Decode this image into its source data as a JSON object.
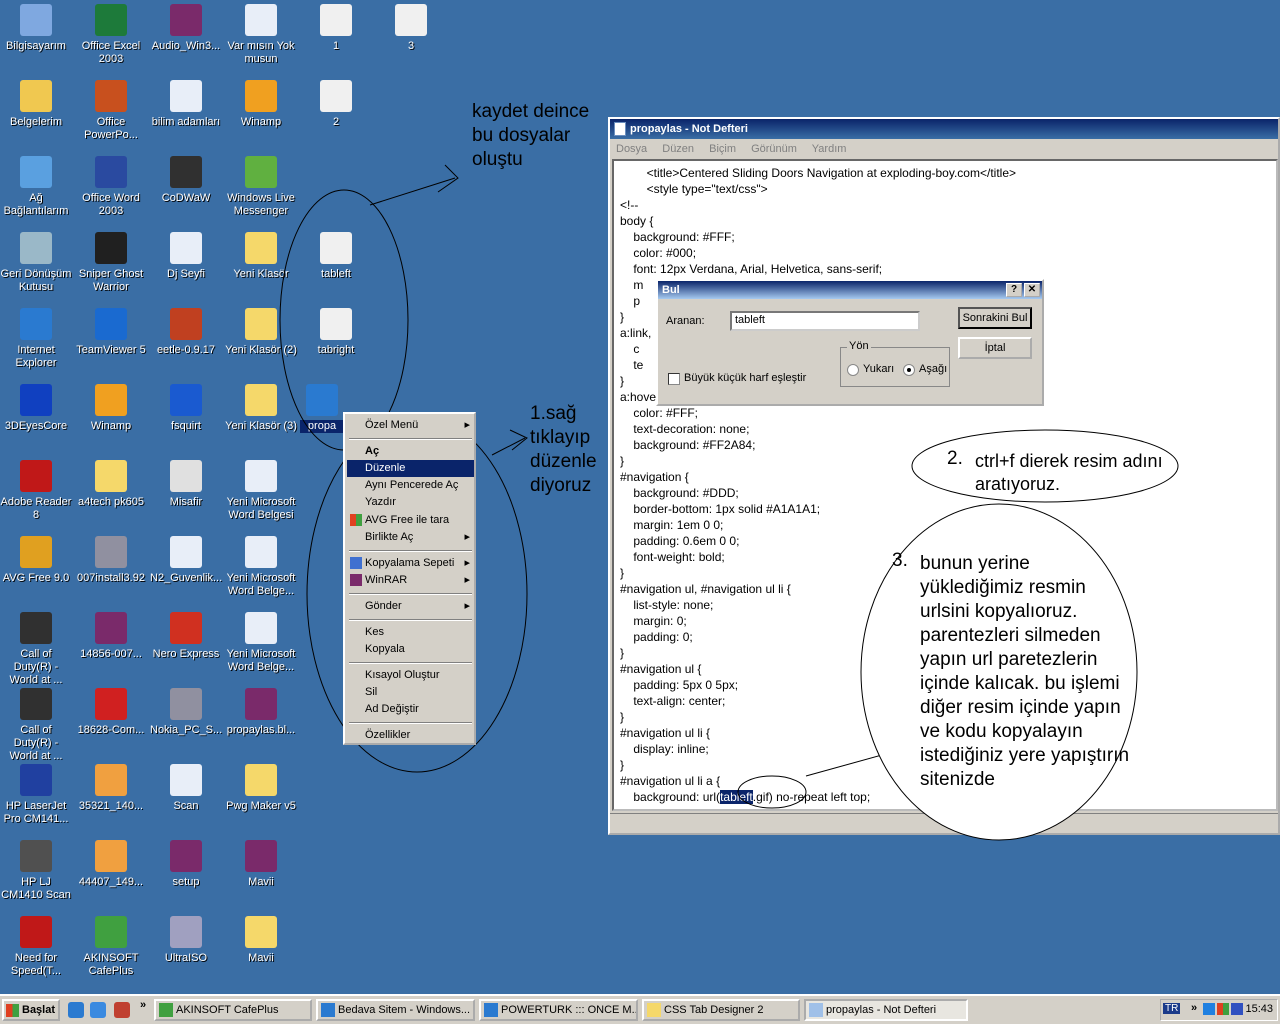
{
  "desktop_icons": [
    {
      "label": "Bilgisayarım",
      "icon": "computer-icon",
      "color": "#7fa8e0"
    },
    {
      "label": "Office Excel 2003",
      "icon": "excel-icon",
      "color": "#1d7a3a"
    },
    {
      "label": "Audio_Win3...",
      "icon": "winrar-archive-icon",
      "color": "#7a2a6a"
    },
    {
      "label": "Var mısın Yok musun",
      "icon": "word-doc-icon",
      "color": "#e8eef8"
    },
    {
      "label": "1",
      "icon": "image-file-icon",
      "color": "#f0f0f0"
    },
    {
      "label": "3",
      "icon": "image-file-icon",
      "color": "#f0f0f0"
    },
    {
      "label": "Belgelerim",
      "icon": "my-documents-icon",
      "color": "#f0c850"
    },
    {
      "label": "Office PowerPo...",
      "icon": "powerpoint-icon",
      "color": "#c8501e"
    },
    {
      "label": "bilim adamları",
      "icon": "word-doc-icon",
      "color": "#e8eef8"
    },
    {
      "label": "Winamp",
      "icon": "winamp-icon",
      "color": "#f0a020"
    },
    {
      "label": "2",
      "icon": "image-file-icon",
      "color": "#f0f0f0"
    },
    {
      "label": "Ağ Bağlantılarım",
      "icon": "network-icon",
      "color": "#5aa0e0"
    },
    {
      "label": "Office Word 2003",
      "icon": "word-icon",
      "color": "#2a4aa0"
    },
    {
      "label": "CoDWaW",
      "icon": "star-game-icon",
      "color": "#303030"
    },
    {
      "label": "Windows Live Messenger",
      "icon": "messenger-icon",
      "color": "#60b040"
    },
    {
      "label": "Geri Dönüşüm Kutusu",
      "icon": "recycle-bin-icon",
      "color": "#9ab8c8"
    },
    {
      "label": "Sniper Ghost Warrior",
      "icon": "crosshair-icon",
      "color": "#202020"
    },
    {
      "label": "Dj Seyfi",
      "icon": "mp3-file-icon",
      "color": "#e8eef8"
    },
    {
      "label": "Yeni Klasör",
      "icon": "folder-icon",
      "color": "#f5d86a"
    },
    {
      "label": "tableft",
      "icon": "image-file-icon",
      "color": "#f0f0f0"
    },
    {
      "label": "Internet Explorer",
      "icon": "internet-explorer-icon",
      "color": "#2a7ad0"
    },
    {
      "label": "TeamViewer 5",
      "icon": "teamviewer-icon",
      "color": "#1a6ad0"
    },
    {
      "label": "eetle-0.9.17",
      "icon": "tv-icon",
      "color": "#c04020"
    },
    {
      "label": "Yeni Klasör (2)",
      "icon": "folder-icon",
      "color": "#f5d86a"
    },
    {
      "label": "tabright",
      "icon": "image-file-icon",
      "color": "#f0f0f0"
    },
    {
      "label": "3DEyesCore",
      "icon": "monitor-icon",
      "color": "#1040c0"
    },
    {
      "label": "Winamp",
      "icon": "winamp-icon",
      "color": "#f0a020"
    },
    {
      "label": "fsquirt",
      "icon": "bluetooth-icon",
      "color": "#1a5ad0"
    },
    {
      "label": "Yeni Klasör (3)",
      "icon": "folder-icon",
      "color": "#f5d86a"
    },
    {
      "label": "Adobe Reader 8",
      "icon": "adobe-reader-icon",
      "color": "#c01818"
    },
    {
      "label": "a4tech pk605",
      "icon": "folder-icon",
      "color": "#f5d86a"
    },
    {
      "label": "Misafir",
      "icon": "media-file-icon",
      "color": "#e0e0e0"
    },
    {
      "label": "Yeni Microsoft Word Belgesi",
      "icon": "word-doc-icon",
      "color": "#e8eef8"
    },
    {
      "label": "AVG Free 9.0",
      "icon": "avg-icon",
      "color": "#e0a020"
    },
    {
      "label": "007install3.92",
      "icon": "installer-icon",
      "color": "#9090a0"
    },
    {
      "label": "N2_Guvenlik...",
      "icon": "word-doc-icon",
      "color": "#e8eef8"
    },
    {
      "label": "Yeni Microsoft Word Belge...",
      "icon": "word-doc-icon",
      "color": "#e8eef8"
    },
    {
      "label": "Call of Duty(R) - World at ...",
      "icon": "star-game-icon",
      "color": "#303030"
    },
    {
      "label": "14856-007...",
      "icon": "winrar-archive-icon",
      "color": "#7a2a6a"
    },
    {
      "label": "Nero Express",
      "icon": "nero-icon",
      "color": "#d03020"
    },
    {
      "label": "Yeni Microsoft Word Belge...",
      "icon": "word-doc-icon",
      "color": "#e8eef8"
    },
    {
      "label": "Call of Duty(R) - World at ...",
      "icon": "star-game-icon",
      "color": "#303030"
    },
    {
      "label": "18628-Com...",
      "icon": "app-icon",
      "color": "#d02020"
    },
    {
      "label": "Nokia_PC_S...",
      "icon": "installer-icon",
      "color": "#9090a0"
    },
    {
      "label": "propaylas.bl...",
      "icon": "winrar-archive-icon",
      "color": "#7a2a6a"
    },
    {
      "label": "HP LaserJet Pro CM141...",
      "icon": "printer-icon",
      "color": "#2040a0"
    },
    {
      "label": "35321_140...",
      "icon": "image-file-icon",
      "color": "#f0a040"
    },
    {
      "label": "Scan",
      "icon": "word-doc-icon",
      "color": "#e8eef8"
    },
    {
      "label": "Pwg Maker v5",
      "icon": "folder-icon",
      "color": "#f5d86a"
    },
    {
      "label": "HP LJ CM1410 Scan",
      "icon": "scanner-icon",
      "color": "#505050"
    },
    {
      "label": "44407_149...",
      "icon": "image-file-icon",
      "color": "#f0a040"
    },
    {
      "label": "setup",
      "icon": "winrar-archive-icon",
      "color": "#7a2a6a"
    },
    {
      "label": "Mavii",
      "icon": "winrar-archive-icon",
      "color": "#7a2a6a"
    },
    {
      "label": "Need for Speed(T...",
      "icon": "nfs-icon",
      "color": "#c01818"
    },
    {
      "label": "AKINSOFT CafePlus",
      "icon": "cafeplus-icon",
      "color": "#40a040"
    },
    {
      "label": "UltraISO",
      "icon": "disc-icon",
      "color": "#a0a0c0"
    },
    {
      "label": "Mavii",
      "icon": "folder-icon",
      "color": "#f5d86a"
    },
    {
      "label": "propa",
      "icon": "internet-explorer-icon",
      "color": "#2a7ad0"
    }
  ],
  "notepad": {
    "title": "propaylas - Not Defteri",
    "menu": [
      "Dosya",
      "Düzen",
      "Biçim",
      "Görünüm",
      "Yardım"
    ],
    "lines": [
      "\t\t<title>Centered Sliding Doors Navigation at exploding-boy.com</title>",
      "\t\t<style type=\"text/css\">",
      "<!--",
      "body {",
      "\tbackground: #FFF;",
      "\tcolor: #000;",
      "\tfont: 12px Verdana, Arial, Helvetica, sans-serif;",
      "\tm",
      "\tp",
      "}",
      "a:link,",
      "\tc",
      "\tte",
      "}",
      "a:hove",
      "\tcolor: #FFF;",
      "\ttext-decoration: none;",
      "\tbackground: #FF2A84;",
      "}",
      "#navigation {",
      "\tbackground: #DDD;",
      "\tborder-bottom: 1px solid #A1A1A1;",
      "\tmargin: 1em 0 0;",
      "\tpadding: 0.6em 0 0;",
      "\tfont-weight: bold;",
      "}",
      "#navigation ul, #navigation ul li {",
      "\tlist-style: none;",
      "\tmargin: 0;",
      "\tpadding: 0;",
      "}",
      "#navigation ul {",
      "\tpadding: 5px 0 5px;",
      "\ttext-align: center;",
      "}",
      "#navigation ul li {",
      "\tdisplay: inline;",
      "}",
      "#navigation ul li a {"
    ],
    "last_line_pre": "\tbackground: url(",
    "last_line_hl": "tableft",
    "last_line_post": ".gif) no-repeat left top;"
  },
  "find_dialog": {
    "title": "Bul",
    "help": "?",
    "close": "✕",
    "search_label": "Aranan:",
    "search_value": "tableft",
    "find_next": "Sonrakini Bul",
    "cancel": "İptal",
    "direction_label": "Yön",
    "up": "Yukarı",
    "down": "Aşağı",
    "match_case": "Büyük küçük harf eşleştir"
  },
  "context_menu": {
    "items": [
      {
        "label": "Özel Menü",
        "arrow": "▸"
      },
      {
        "label": "Aç",
        "bold": true
      },
      {
        "label": "Düzenle",
        "selected": true
      },
      {
        "label": "Aynı Pencerede Aç"
      },
      {
        "label": "Yazdır"
      },
      {
        "label": "AVG Free ile tara",
        "icon": "avg-icon"
      },
      {
        "label": "Birlikte Aç",
        "arrow": "▸"
      },
      {
        "label": "Kopyalama Sepeti",
        "arrow": "▸",
        "icon": "basket-icon"
      },
      {
        "label": "WinRAR",
        "arrow": "▸",
        "icon": "winrar-icon"
      },
      {
        "label": "Gönder",
        "arrow": "▸"
      },
      {
        "label": "Kes"
      },
      {
        "label": "Kopyala"
      },
      {
        "label": "Kısayol Oluştur"
      },
      {
        "label": "Sil"
      },
      {
        "label": "Ad Değiştir"
      },
      {
        "label": "Özellikler"
      }
    ]
  },
  "annotations": {
    "a1": "kaydet deince bu dosyalar oluştu",
    "a2": "1.sağ tıklayıp düzenle diyoruz",
    "a3_num": "2.",
    "a3": "ctrl+f dierek resim adını aratıyoruz.",
    "a4_num": "3.",
    "a4": "bunun yerine yüklediğimiz resmin urlsini kopyalıoruz. parentezleri silmeden yapın url paretezlerin içinde kalıcak. bu işlemi diğer resim içinde yapın ve kodu kopyalayın istediğiniz yere yapıştırın sitenizde"
  },
  "taskbar": {
    "start": "Başlat",
    "tasks": [
      {
        "label": "AKINSOFT CafePlus",
        "icon": "cafeplus-icon"
      },
      {
        "label": "Bedava Sitem - Windows...",
        "icon": "internet-explorer-icon"
      },
      {
        "label": "POWERTURK ::: ONCE M...",
        "icon": "internet-explorer-icon"
      },
      {
        "label": "CSS Tab Designer 2",
        "icon": "folder-icon"
      },
      {
        "label": "propaylas - Not Defteri",
        "icon": "notepad-icon",
        "active": true
      }
    ],
    "lang": "TR",
    "clock": "15:43",
    "chevron": "»"
  }
}
